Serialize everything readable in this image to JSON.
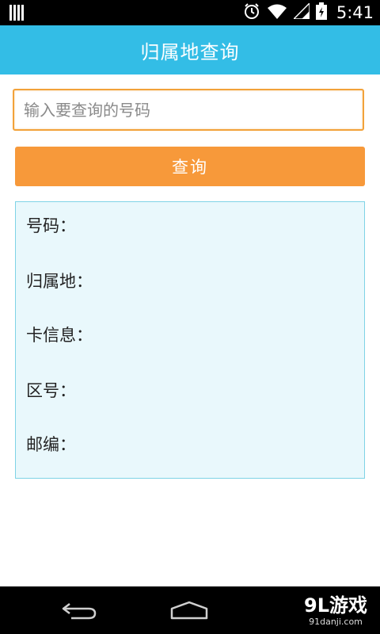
{
  "status_bar": {
    "time": "5:41",
    "icons": [
      "barcode-icon",
      "alarm-icon",
      "wifi-icon",
      "signal-icon",
      "battery-icon"
    ]
  },
  "title_bar": {
    "title": "归属地查询",
    "background": "#33bde6"
  },
  "search": {
    "placeholder": "输入要查询的号码",
    "value": ""
  },
  "query_button": {
    "label": "查询",
    "background": "#f7993a"
  },
  "results": {
    "background": "#e9f8fc",
    "rows": [
      {
        "label": "号码："
      },
      {
        "label": "归属地："
      },
      {
        "label": "卡信息："
      },
      {
        "label": "区号："
      },
      {
        "label": "邮编："
      }
    ]
  },
  "nav_bar": {
    "icons": [
      "back-icon",
      "home-icon"
    ],
    "brand": {
      "logo": "9L游戏",
      "url": "91danji.com"
    }
  }
}
